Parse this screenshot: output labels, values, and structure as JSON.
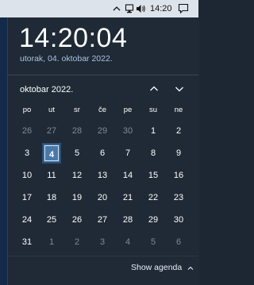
{
  "taskbar": {
    "time": "14:20",
    "icons": [
      "chevron-up-icon",
      "network-icon",
      "speaker-icon",
      "notification-icon"
    ]
  },
  "clock": {
    "time": "14:20:04",
    "date": "utorak, 04. oktobar 2022."
  },
  "calendar": {
    "month_label": "oktobar 2022.",
    "weekdays": [
      "po",
      "ut",
      "sr",
      "če",
      "pe",
      "su",
      "ne"
    ],
    "weeks": [
      [
        {
          "d": "26",
          "m": true
        },
        {
          "d": "27",
          "m": true
        },
        {
          "d": "28",
          "m": true
        },
        {
          "d": "29",
          "m": true
        },
        {
          "d": "30",
          "m": true
        },
        {
          "d": "1",
          "m": false
        },
        {
          "d": "2",
          "m": false
        }
      ],
      [
        {
          "d": "3",
          "m": false
        },
        {
          "d": "4",
          "m": false,
          "today": true
        },
        {
          "d": "5",
          "m": false
        },
        {
          "d": "6",
          "m": false
        },
        {
          "d": "7",
          "m": false
        },
        {
          "d": "8",
          "m": false
        },
        {
          "d": "9",
          "m": false
        }
      ],
      [
        {
          "d": "10",
          "m": false
        },
        {
          "d": "11",
          "m": false
        },
        {
          "d": "12",
          "m": false
        },
        {
          "d": "13",
          "m": false
        },
        {
          "d": "14",
          "m": false
        },
        {
          "d": "15",
          "m": false
        },
        {
          "d": "16",
          "m": false
        }
      ],
      [
        {
          "d": "17",
          "m": false
        },
        {
          "d": "18",
          "m": false
        },
        {
          "d": "19",
          "m": false
        },
        {
          "d": "20",
          "m": false
        },
        {
          "d": "21",
          "m": false
        },
        {
          "d": "22",
          "m": false
        },
        {
          "d": "23",
          "m": false
        }
      ],
      [
        {
          "d": "24",
          "m": false
        },
        {
          "d": "25",
          "m": false
        },
        {
          "d": "26",
          "m": false
        },
        {
          "d": "27",
          "m": false
        },
        {
          "d": "28",
          "m": false
        },
        {
          "d": "29",
          "m": false
        },
        {
          "d": "30",
          "m": false
        }
      ],
      [
        {
          "d": "31",
          "m": false
        },
        {
          "d": "1",
          "m": true
        },
        {
          "d": "2",
          "m": true
        },
        {
          "d": "3",
          "m": true
        },
        {
          "d": "4",
          "m": true
        },
        {
          "d": "5",
          "m": true
        },
        {
          "d": "6",
          "m": true
        }
      ]
    ]
  },
  "agenda": {
    "label": "Show agenda"
  },
  "colors": {
    "accent": "#4a79a8",
    "flyout_bg": "#1f2a36",
    "date_text": "#a8c4e4"
  }
}
